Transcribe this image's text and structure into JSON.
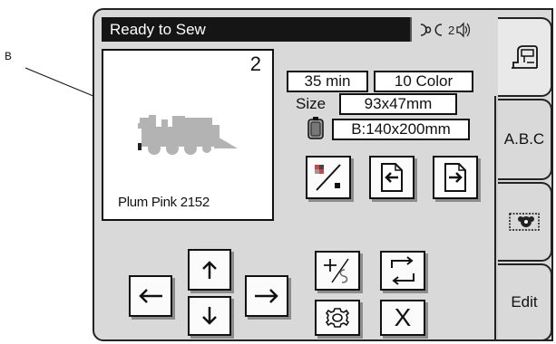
{
  "callout": {
    "label": "B"
  },
  "status_bar": {
    "text": "Ready to Sew"
  },
  "thread_indicator": {
    "count": "2",
    "icons": [
      "thread-spool-icon",
      "speaker-icon"
    ]
  },
  "preview": {
    "pattern_number": "2",
    "thread_color": "Plum Pink 2152",
    "image": "locomotive-embroidery-pattern"
  },
  "info": {
    "time": "35 min",
    "colors": "10 Color",
    "size_label": "Size",
    "size": "93x47mm",
    "hoop": "B:140x200mm"
  },
  "buttons": {
    "color_sort": "color-sort-icon",
    "prev_pattern": "page-left-arrow-icon",
    "next_pattern": "page-right-arrow-icon",
    "move_up": "arrow-up-icon",
    "move_left": "arrow-left-icon",
    "move_right": "arrow-right-icon",
    "move_down": "arrow-down-icon",
    "center": "center-cross-icon",
    "rotate": "rotate-icon",
    "settings": "gear-icon",
    "cancel_label": "X"
  },
  "tabs": {
    "sewing_machine": "sewing-machine-icon",
    "abc_label": "A.B.C",
    "pattern": "embroidery-pattern-icon",
    "edit_label": "Edit"
  },
  "colors": {
    "screen": "#d9d9d9",
    "status_bar": "#151515",
    "pattern": "#b3b3b3",
    "button": "#fbfbfb"
  }
}
